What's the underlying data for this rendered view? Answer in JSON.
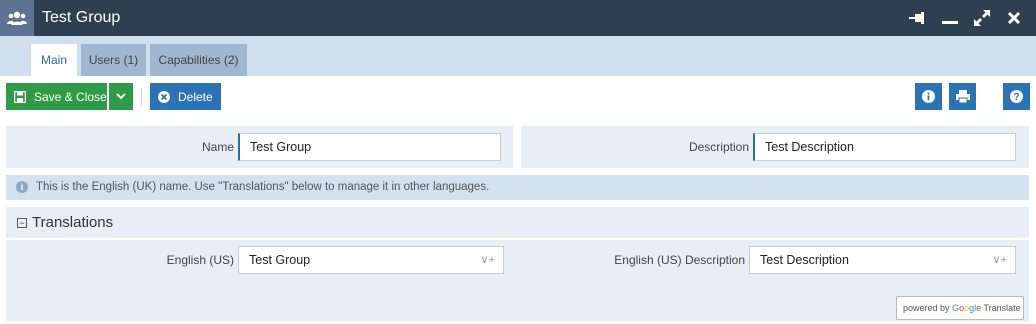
{
  "window": {
    "title": "Test Group",
    "controls": [
      "pin-icon",
      "minimize-icon",
      "maximize-icon",
      "close-icon"
    ]
  },
  "tabs": [
    {
      "label": "Main",
      "active": true
    },
    {
      "label": "Users (1)",
      "active": false
    },
    {
      "label": "Capabilities (2)",
      "active": false
    }
  ],
  "toolbar": {
    "save_close_label": "Save & Close",
    "delete_label": "Delete"
  },
  "form": {
    "name_label": "Name",
    "name_value": "Test Group",
    "description_label": "Description",
    "description_value": "Test Description"
  },
  "info_message": "This is the English (UK) name. Use \"Translations\" below to manage it in other languages.",
  "translations": {
    "title": "Translations",
    "name_label": "English (US)",
    "name_value": "Test Group",
    "description_label": "English (US) Description",
    "description_value": "Test Description"
  },
  "google_translate": {
    "prefix": "powered by",
    "brand": "Google",
    "suffix": "Translate"
  },
  "colors": {
    "titlebar": "#2e3f52",
    "accent_blue": "#2b73b4",
    "accent_green": "#2f9a48"
  }
}
